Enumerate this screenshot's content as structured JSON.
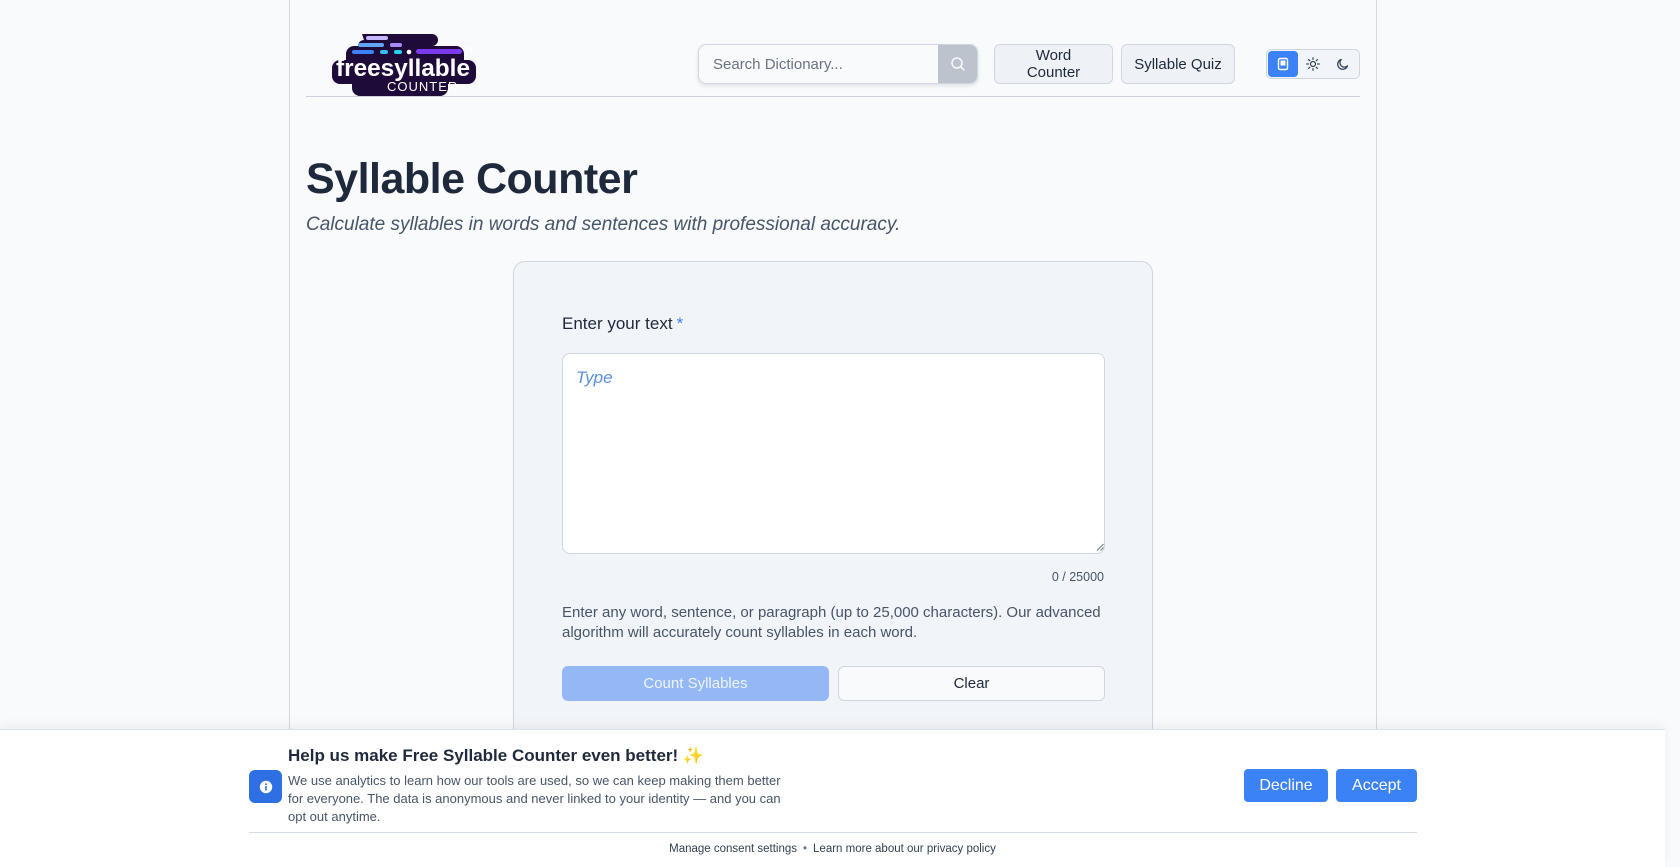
{
  "header": {
    "logo": {
      "alt": "freesyllable counter",
      "word": "freesyllable",
      "subword": "COUNTER",
      "mark": "R"
    },
    "search": {
      "placeholder": "Search Dictionary...",
      "value": ""
    },
    "nav": {
      "word_counter": "Word Counter",
      "syllable_quiz": "Syllable Quiz"
    },
    "theme_modes": [
      "system-icon",
      "sun-icon",
      "moon-icon"
    ],
    "active_theme": "system"
  },
  "main": {
    "title": "Syllable Counter",
    "subtitle": "Calculate syllables in words and sentences with professional accuracy."
  },
  "form": {
    "label": "Enter your text",
    "required_mark": "*",
    "textarea_placeholder": "Type",
    "textarea_value": "",
    "char_count": "0 / 25000",
    "help": "Enter any word, sentence, or paragraph (up to 25,000 characters). Our advanced algorithm will accurately count syllables in each word.",
    "count_button": "Count Syllables",
    "clear_button": "Clear"
  },
  "consent": {
    "title": "Help us make Free Syllable Counter even better! ✨",
    "body": "We use analytics to learn how our tools are used, so we can keep making them better for everyone. The data is anonymous and never linked to your identity — and you can opt out anytime.",
    "decline": "Decline",
    "accept": "Accept",
    "manage_link": "Manage consent settings",
    "separator": "•",
    "privacy_link": "Learn more about our privacy policy"
  },
  "colors": {
    "accent": "#3b82f6",
    "accent_disabled": "#93b8f5",
    "text": "#1e293b",
    "muted": "#475569",
    "background": "#f8fafc",
    "logo_bg": "#1e0b3a"
  }
}
